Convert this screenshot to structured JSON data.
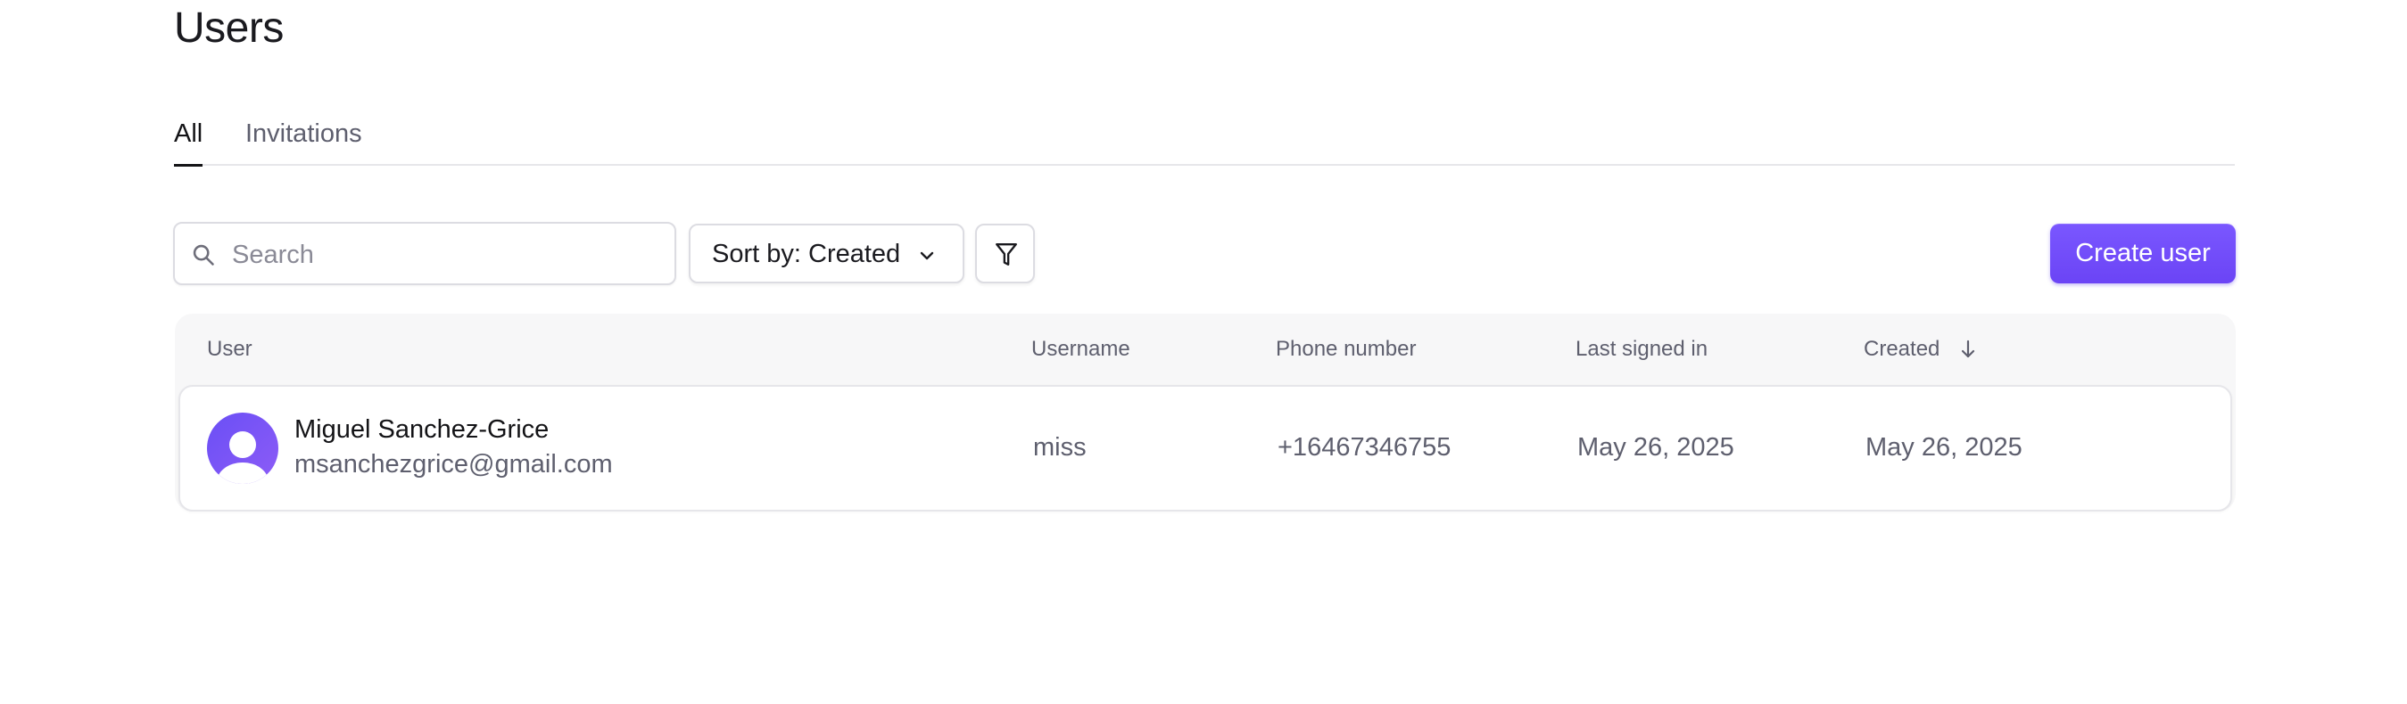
{
  "page": {
    "title": "Users"
  },
  "tabs": [
    {
      "label": "All",
      "active": true
    },
    {
      "label": "Invitations",
      "active": false
    }
  ],
  "toolbar": {
    "search_placeholder": "Search",
    "sort_label": "Sort by:",
    "sort_value": "Created",
    "filter_icon": "filter-icon",
    "create_label": "Create user"
  },
  "table": {
    "columns": [
      "User",
      "Username",
      "Phone number",
      "Last signed in",
      "Created"
    ],
    "sorted_column": "Created",
    "sort_direction": "descending",
    "rows": [
      {
        "name": "Miguel Sanchez-Grice",
        "email": "msanchezgrice@gmail.com",
        "username": "miss",
        "phone": "+16467346755",
        "last_signed_in": "May 26, 2025",
        "created": "May 26, 2025"
      }
    ]
  },
  "colors": {
    "accent": "#6c47ff",
    "text_primary": "#131316",
    "text_secondary": "#5e5f6e",
    "header_bg": "#f7f7f8"
  }
}
